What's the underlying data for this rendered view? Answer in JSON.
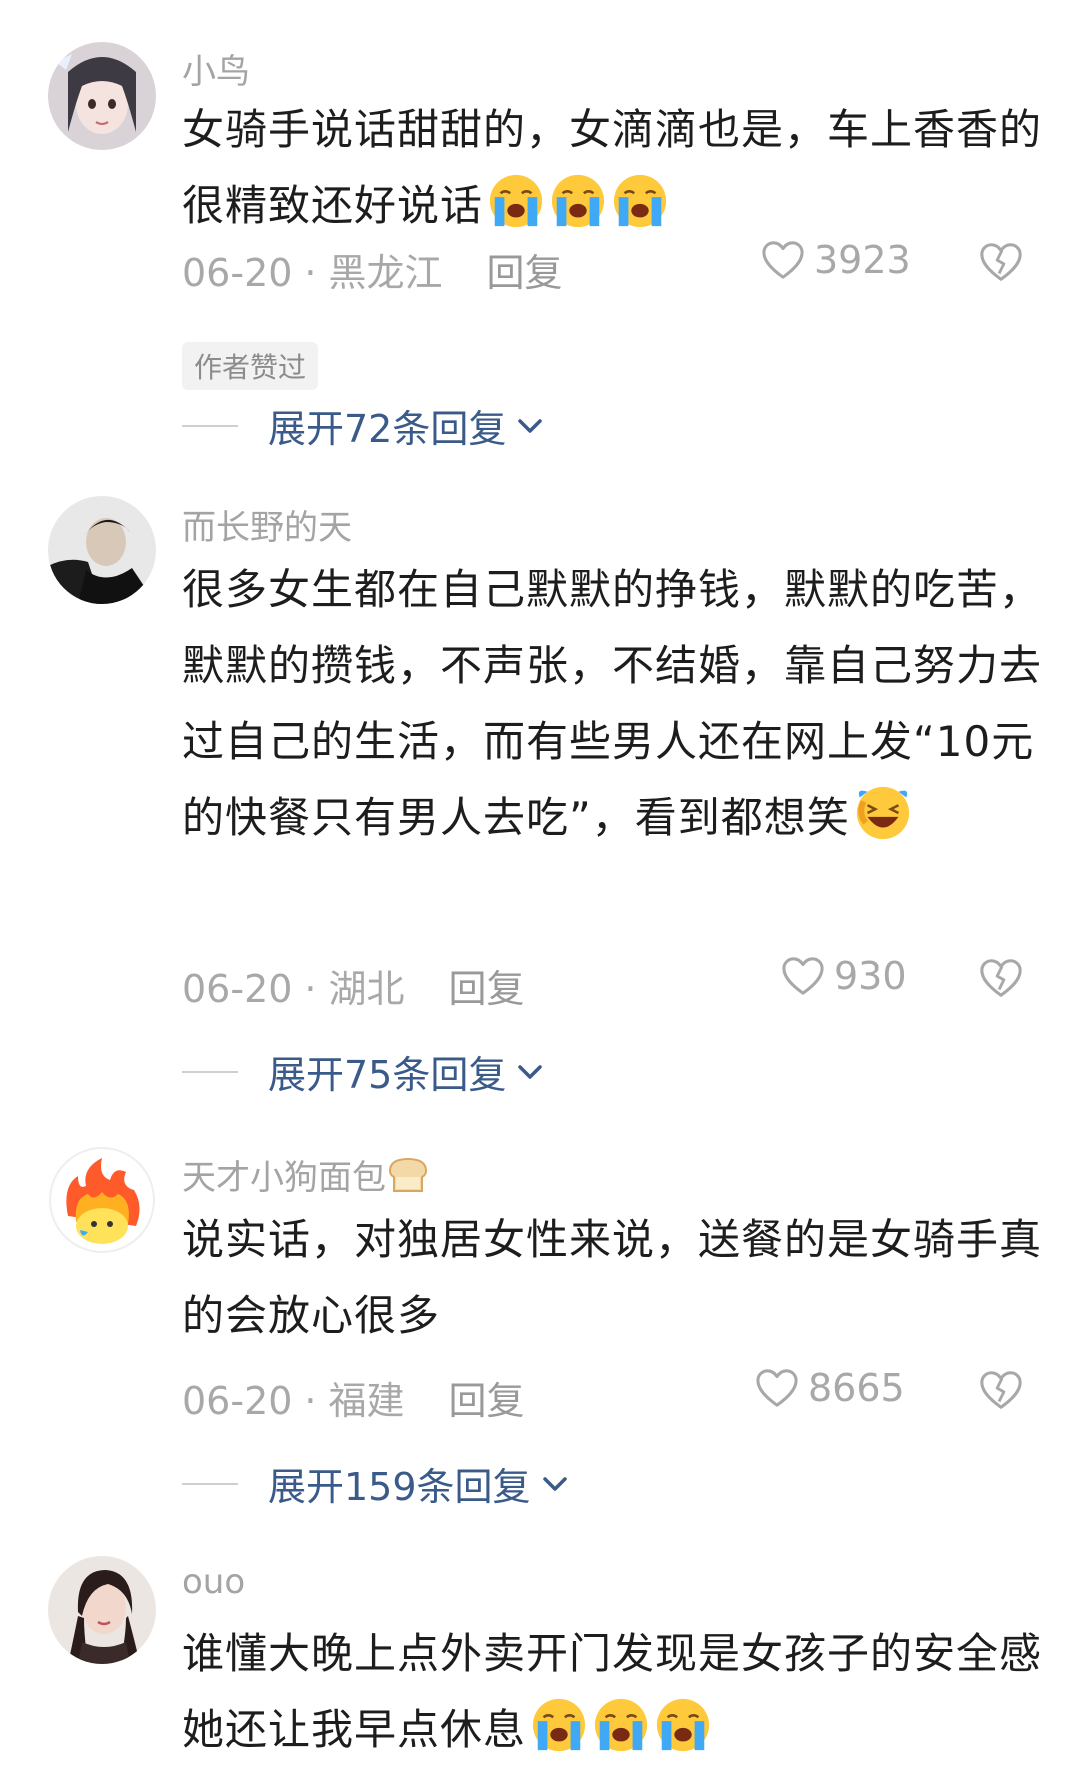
{
  "comments": [
    {
      "username": "小鸟",
      "text": "女骑手说话甜甜的，女滴滴也是，车上香香的很精致还好说话",
      "emoji_count": 3,
      "date": "06-20",
      "location": "黑龙江",
      "reply_label": "回复",
      "likes": "3923",
      "badge": "作者赞过",
      "expand_label": "展开72条回复"
    },
    {
      "username": "而长野的天",
      "text": "很多女生都在自己默默的挣钱，默默的吃苦，默默的攒钱，不声张，不结婚，靠自己努力去过自己的生活，而有些男人还在网上发“10元的快餐只有男人去吃”，看到都想笑",
      "emoji_count": 1,
      "date": "06-20",
      "location": "湖北",
      "reply_label": "回复",
      "likes": "930",
      "expand_label": "展开75条回复"
    },
    {
      "username": "天才小狗面包",
      "text": "说实话，对独居女性来说，送餐的是女骑手真的会放心很多",
      "date": "06-20",
      "location": "福建",
      "reply_label": "回复",
      "likes": "8665",
      "expand_label": "展开159条回复"
    },
    {
      "username": "ouo",
      "text": "谁懂大晚上点外卖开门发现是女孩子的安全感 她还让我早点休息",
      "emoji_count": 3
    }
  ],
  "colors": {
    "username": "#a4a4a4",
    "expand_link": "#3a5a8a",
    "badge_bg": "#f2f2f2",
    "emoji_face": "#ffc93c",
    "emoji_tear": "#3fa9f5"
  },
  "icons": [
    "heart-icon",
    "broken-heart-icon",
    "chevron-down-icon",
    "crying-emoji-icon",
    "laughing-emoji-icon",
    "bread-emoji-icon"
  ]
}
